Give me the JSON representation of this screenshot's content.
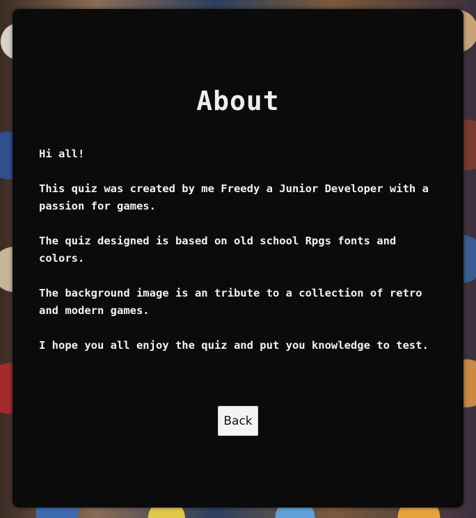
{
  "page": {
    "title": "About",
    "paragraphs": [
      "Hi all!",
      "This quiz was created by me Freedy a Junior Developer with a passion for games.",
      "The quiz designed is based on old school Rpgs fonts and colors.",
      "The background image is an tribute to a collection of retro and modern games.",
      "I hope you all enjoy the quiz and put you knowledge to test."
    ],
    "back_label": "Back"
  },
  "colors": {
    "panel_background": "#0b0b0b",
    "text": "#f2f2f2",
    "button_background": "#f4f4f4"
  }
}
